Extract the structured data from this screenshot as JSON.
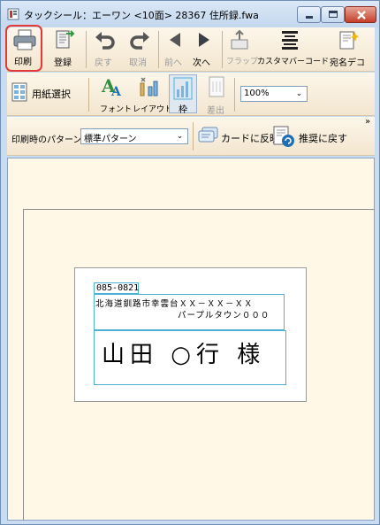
{
  "window": {
    "title": "タックシール：エーワン <10面> 28367  住所録.fwa"
  },
  "toolbar1": {
    "print": "印刷",
    "register": "登録",
    "undo": "戻す",
    "cancel": "取消",
    "prev": "前へ",
    "next": "次へ",
    "flap": "フラップ",
    "custom_barcode": "カスタマバーコード",
    "addressee_deco": "宛名デコ"
  },
  "toolbar2": {
    "paper_select": "用紙選択",
    "font": "フォント",
    "layout": "レイアウト",
    "frame": "枠",
    "sender": "差出",
    "zoom": "100%"
  },
  "toolbar3": {
    "print_pattern_label": "印刷時のパターン",
    "print_pattern_value": "標準パターン",
    "apply_to_card": "カードに反映",
    "reset_recommended": "推奨に戻す",
    "overflow": "»"
  },
  "label": {
    "postal_code": "085-0821",
    "address_line1": "北海道釧路市幸雲台ＸＸ－ＸＸ－ＸＸ",
    "address_line2": "パープルタウン０００",
    "name": "山田 ○行 様"
  },
  "colors": {
    "print_highlight": "#e53935",
    "field_border": "#4db0d6",
    "canvas_bg": "#fff8e6"
  }
}
